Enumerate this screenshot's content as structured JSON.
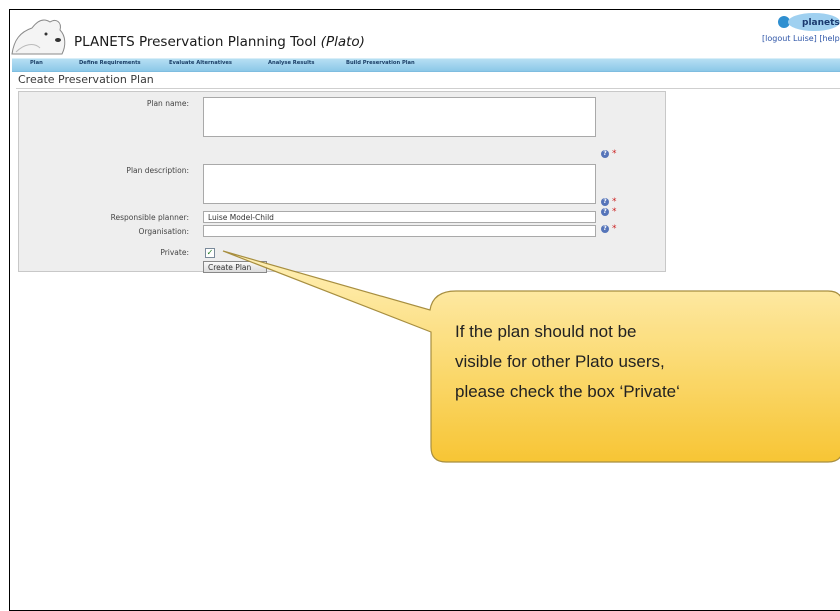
{
  "header": {
    "app_title": "PLANETS Preservation Planning Tool ",
    "app_title_tool": "(Plato)",
    "logo_text": "planets",
    "logout_link": "[logout Luise]",
    "help_link": "[help"
  },
  "nav": {
    "items": [
      {
        "label": "Plan"
      },
      {
        "label": "Define Requirements"
      },
      {
        "label": "Evaluate Alternatives"
      },
      {
        "label": "Analyse Results"
      },
      {
        "label": "Build Preservation Plan"
      }
    ]
  },
  "page": {
    "title": "Create Preservation Plan"
  },
  "form": {
    "plan_name_label": "Plan name:",
    "plan_name_value": "",
    "plan_description_label": "Plan description:",
    "plan_description_value": "",
    "responsible_planner_label": "Responsible planner:",
    "responsible_planner_value": "Luise Model-Child",
    "organisation_label": "Organisation:",
    "organisation_value": "",
    "private_label": "Private:",
    "private_checked": true,
    "required_marker": "*",
    "help_icon": "?",
    "create_button": "Create Plan"
  },
  "callout": {
    "lines": [
      "If the plan should not be",
      "visible for other Plato users,",
      "please check the box ‘Private‘"
    ]
  },
  "colors": {
    "nav_bar": "#8cc8e8",
    "callout_fill": "#fbd25c",
    "link": "#2f56a8",
    "required": "#cc2222"
  }
}
